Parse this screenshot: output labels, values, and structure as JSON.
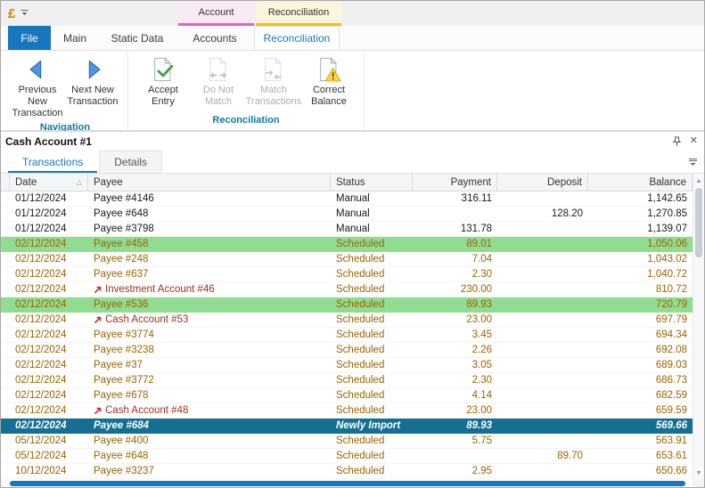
{
  "colors": {
    "accent_blue": "#1777BE",
    "contextual_pink": "#E85DC8",
    "contextual_yellow": "#EFC20F",
    "group_caption": "#0E7C9E",
    "selected_row_bg": "#156F93",
    "green_row_bg": "#90DC90",
    "scheduled_text": "#9A6400",
    "transfer_text": "#A03020"
  },
  "icons": {
    "sort_asc": "△",
    "close": "✕",
    "scroll_up": "▲",
    "scroll_down": "▼"
  },
  "titlebar": {
    "app_button": "£"
  },
  "contextual": {
    "account_label": "Account",
    "reconciliation_label": "Reconciliation"
  },
  "ribbon": {
    "tabs": [
      {
        "label": "File",
        "style": "file"
      },
      {
        "label": "Main"
      },
      {
        "label": "Static Data"
      },
      {
        "label": "Accounts"
      },
      {
        "label": "Reconciliation",
        "active": true
      }
    ],
    "groups": [
      {
        "label": "Navigation",
        "buttons": [
          {
            "label": "Previous New Transaction",
            "icon": "previous-arrow",
            "enabled": true
          },
          {
            "label": "Next New Transaction",
            "icon": "next-arrow",
            "enabled": true
          }
        ]
      },
      {
        "label": "Reconciliation",
        "buttons": [
          {
            "label": "Accept Entry",
            "icon": "accept-entry",
            "enabled": true
          },
          {
            "label": "Do Not Match",
            "icon": "do-not-match",
            "enabled": false
          },
          {
            "label": "Match Transactions",
            "icon": "match-transactions",
            "enabled": false
          },
          {
            "label": "Correct Balance",
            "icon": "correct-balance",
            "enabled": true
          }
        ]
      }
    ]
  },
  "panel": {
    "title": "Cash Account #1",
    "tabs": [
      {
        "label": "Transactions",
        "active": true
      },
      {
        "label": "Details",
        "active": false
      }
    ]
  },
  "grid": {
    "columns": [
      {
        "key": "date",
        "label": "Date",
        "sort": "asc"
      },
      {
        "key": "payee",
        "label": "Payee"
      },
      {
        "key": "status",
        "label": "Status"
      },
      {
        "key": "payment",
        "label": "Payment"
      },
      {
        "key": "deposit",
        "label": "Deposit"
      },
      {
        "key": "balance",
        "label": "Balance"
      }
    ],
    "rows": [
      {
        "date": "01/12/2024",
        "payee": "Payee #4146",
        "status": "Manual",
        "payment": "316.11",
        "deposit": "",
        "balance": "1,142.65",
        "style": "manual"
      },
      {
        "date": "01/12/2024",
        "payee": "Payee #648",
        "status": "Manual",
        "payment": "",
        "deposit": "128.20",
        "balance": "1,270.85",
        "style": "manual"
      },
      {
        "date": "01/12/2024",
        "payee": "Payee #3798",
        "status": "Manual",
        "payment": "131.78",
        "deposit": "",
        "balance": "1,139.07",
        "style": "manual"
      },
      {
        "date": "02/12/2024",
        "payee": "Payee #458",
        "status": "Scheduled",
        "payment": "89.01",
        "deposit": "",
        "balance": "1,050.06",
        "style": "scheduled",
        "highlight": "green"
      },
      {
        "date": "02/12/2024",
        "payee": "Payee #248",
        "status": "Scheduled",
        "payment": "7.04",
        "deposit": "",
        "balance": "1,043.02",
        "style": "scheduled"
      },
      {
        "date": "02/12/2024",
        "payee": "Payee #637",
        "status": "Scheduled",
        "payment": "2.30",
        "deposit": "",
        "balance": "1,040.72",
        "style": "scheduled"
      },
      {
        "date": "02/12/2024",
        "payee": "Investment Account #46",
        "status": "Scheduled",
        "payment": "230.00",
        "deposit": "",
        "balance": "810.72",
        "style": "scheduled",
        "transfer": true
      },
      {
        "date": "02/12/2024",
        "payee": "Payee #536",
        "status": "Scheduled",
        "payment": "89.93",
        "deposit": "",
        "balance": "720.79",
        "style": "scheduled",
        "highlight": "green"
      },
      {
        "date": "02/12/2024",
        "payee": "Cash Account #53",
        "status": "Scheduled",
        "payment": "23.00",
        "deposit": "",
        "balance": "697.79",
        "style": "scheduled",
        "transfer": true
      },
      {
        "date": "02/12/2024",
        "payee": "Payee #3774",
        "status": "Scheduled",
        "payment": "3.45",
        "deposit": "",
        "balance": "694.34",
        "style": "scheduled"
      },
      {
        "date": "02/12/2024",
        "payee": "Payee #3238",
        "status": "Scheduled",
        "payment": "2.26",
        "deposit": "",
        "balance": "692.08",
        "style": "scheduled"
      },
      {
        "date": "02/12/2024",
        "payee": "Payee #37",
        "status": "Scheduled",
        "payment": "3.05",
        "deposit": "",
        "balance": "689.03",
        "style": "scheduled"
      },
      {
        "date": "02/12/2024",
        "payee": "Payee #3772",
        "status": "Scheduled",
        "payment": "2.30",
        "deposit": "",
        "balance": "686.73",
        "style": "scheduled"
      },
      {
        "date": "02/12/2024",
        "payee": "Payee #678",
        "status": "Scheduled",
        "payment": "4.14",
        "deposit": "",
        "balance": "682.59",
        "style": "scheduled"
      },
      {
        "date": "02/12/2024",
        "payee": "Cash Account #48",
        "status": "Scheduled",
        "payment": "23.00",
        "deposit": "",
        "balance": "659.59",
        "style": "scheduled",
        "transfer": true
      },
      {
        "date": "02/12/2024",
        "payee": "Payee #684",
        "status": "Newly Import",
        "payment": "89.93",
        "deposit": "",
        "balance": "569.66",
        "style": "scheduled",
        "selected": true
      },
      {
        "date": "05/12/2024",
        "payee": "Payee #400",
        "status": "Scheduled",
        "payment": "5.75",
        "deposit": "",
        "balance": "563.91",
        "style": "scheduled"
      },
      {
        "date": "05/12/2024",
        "payee": "Payee #648",
        "status": "Scheduled",
        "payment": "",
        "deposit": "89.70",
        "balance": "653.61",
        "style": "scheduled"
      },
      {
        "date": "10/12/2024",
        "payee": "Payee #3237",
        "status": "Scheduled",
        "payment": "2.95",
        "deposit": "",
        "balance": "650.66",
        "style": "scheduled"
      }
    ]
  }
}
